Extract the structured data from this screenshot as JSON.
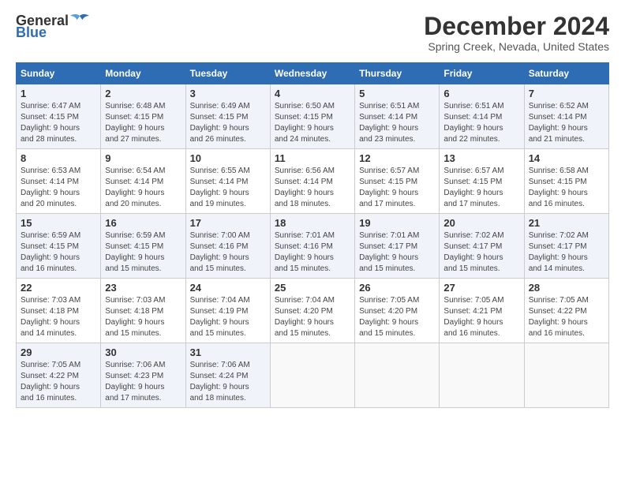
{
  "header": {
    "logo_general": "General",
    "logo_blue": "Blue",
    "title": "December 2024",
    "subtitle": "Spring Creek, Nevada, United States"
  },
  "weekdays": [
    "Sunday",
    "Monday",
    "Tuesday",
    "Wednesday",
    "Thursday",
    "Friday",
    "Saturday"
  ],
  "weeks": [
    [
      {
        "day": "1",
        "info": "Sunrise: 6:47 AM\nSunset: 4:15 PM\nDaylight: 9 hours\nand 28 minutes."
      },
      {
        "day": "2",
        "info": "Sunrise: 6:48 AM\nSunset: 4:15 PM\nDaylight: 9 hours\nand 27 minutes."
      },
      {
        "day": "3",
        "info": "Sunrise: 6:49 AM\nSunset: 4:15 PM\nDaylight: 9 hours\nand 26 minutes."
      },
      {
        "day": "4",
        "info": "Sunrise: 6:50 AM\nSunset: 4:15 PM\nDaylight: 9 hours\nand 24 minutes."
      },
      {
        "day": "5",
        "info": "Sunrise: 6:51 AM\nSunset: 4:14 PM\nDaylight: 9 hours\nand 23 minutes."
      },
      {
        "day": "6",
        "info": "Sunrise: 6:51 AM\nSunset: 4:14 PM\nDaylight: 9 hours\nand 22 minutes."
      },
      {
        "day": "7",
        "info": "Sunrise: 6:52 AM\nSunset: 4:14 PM\nDaylight: 9 hours\nand 21 minutes."
      }
    ],
    [
      {
        "day": "8",
        "info": "Sunrise: 6:53 AM\nSunset: 4:14 PM\nDaylight: 9 hours\nand 20 minutes."
      },
      {
        "day": "9",
        "info": "Sunrise: 6:54 AM\nSunset: 4:14 PM\nDaylight: 9 hours\nand 20 minutes."
      },
      {
        "day": "10",
        "info": "Sunrise: 6:55 AM\nSunset: 4:14 PM\nDaylight: 9 hours\nand 19 minutes."
      },
      {
        "day": "11",
        "info": "Sunrise: 6:56 AM\nSunset: 4:14 PM\nDaylight: 9 hours\nand 18 minutes."
      },
      {
        "day": "12",
        "info": "Sunrise: 6:57 AM\nSunset: 4:15 PM\nDaylight: 9 hours\nand 17 minutes."
      },
      {
        "day": "13",
        "info": "Sunrise: 6:57 AM\nSunset: 4:15 PM\nDaylight: 9 hours\nand 17 minutes."
      },
      {
        "day": "14",
        "info": "Sunrise: 6:58 AM\nSunset: 4:15 PM\nDaylight: 9 hours\nand 16 minutes."
      }
    ],
    [
      {
        "day": "15",
        "info": "Sunrise: 6:59 AM\nSunset: 4:15 PM\nDaylight: 9 hours\nand 16 minutes."
      },
      {
        "day": "16",
        "info": "Sunrise: 6:59 AM\nSunset: 4:15 PM\nDaylight: 9 hours\nand 15 minutes."
      },
      {
        "day": "17",
        "info": "Sunrise: 7:00 AM\nSunset: 4:16 PM\nDaylight: 9 hours\nand 15 minutes."
      },
      {
        "day": "18",
        "info": "Sunrise: 7:01 AM\nSunset: 4:16 PM\nDaylight: 9 hours\nand 15 minutes."
      },
      {
        "day": "19",
        "info": "Sunrise: 7:01 AM\nSunset: 4:17 PM\nDaylight: 9 hours\nand 15 minutes."
      },
      {
        "day": "20",
        "info": "Sunrise: 7:02 AM\nSunset: 4:17 PM\nDaylight: 9 hours\nand 15 minutes."
      },
      {
        "day": "21",
        "info": "Sunrise: 7:02 AM\nSunset: 4:17 PM\nDaylight: 9 hours\nand 14 minutes."
      }
    ],
    [
      {
        "day": "22",
        "info": "Sunrise: 7:03 AM\nSunset: 4:18 PM\nDaylight: 9 hours\nand 14 minutes."
      },
      {
        "day": "23",
        "info": "Sunrise: 7:03 AM\nSunset: 4:18 PM\nDaylight: 9 hours\nand 15 minutes."
      },
      {
        "day": "24",
        "info": "Sunrise: 7:04 AM\nSunset: 4:19 PM\nDaylight: 9 hours\nand 15 minutes."
      },
      {
        "day": "25",
        "info": "Sunrise: 7:04 AM\nSunset: 4:20 PM\nDaylight: 9 hours\nand 15 minutes."
      },
      {
        "day": "26",
        "info": "Sunrise: 7:05 AM\nSunset: 4:20 PM\nDaylight: 9 hours\nand 15 minutes."
      },
      {
        "day": "27",
        "info": "Sunrise: 7:05 AM\nSunset: 4:21 PM\nDaylight: 9 hours\nand 16 minutes."
      },
      {
        "day": "28",
        "info": "Sunrise: 7:05 AM\nSunset: 4:22 PM\nDaylight: 9 hours\nand 16 minutes."
      }
    ],
    [
      {
        "day": "29",
        "info": "Sunrise: 7:05 AM\nSunset: 4:22 PM\nDaylight: 9 hours\nand 16 minutes."
      },
      {
        "day": "30",
        "info": "Sunrise: 7:06 AM\nSunset: 4:23 PM\nDaylight: 9 hours\nand 17 minutes."
      },
      {
        "day": "31",
        "info": "Sunrise: 7:06 AM\nSunset: 4:24 PM\nDaylight: 9 hours\nand 18 minutes."
      },
      {
        "day": "",
        "info": ""
      },
      {
        "day": "",
        "info": ""
      },
      {
        "day": "",
        "info": ""
      },
      {
        "day": "",
        "info": ""
      }
    ]
  ]
}
